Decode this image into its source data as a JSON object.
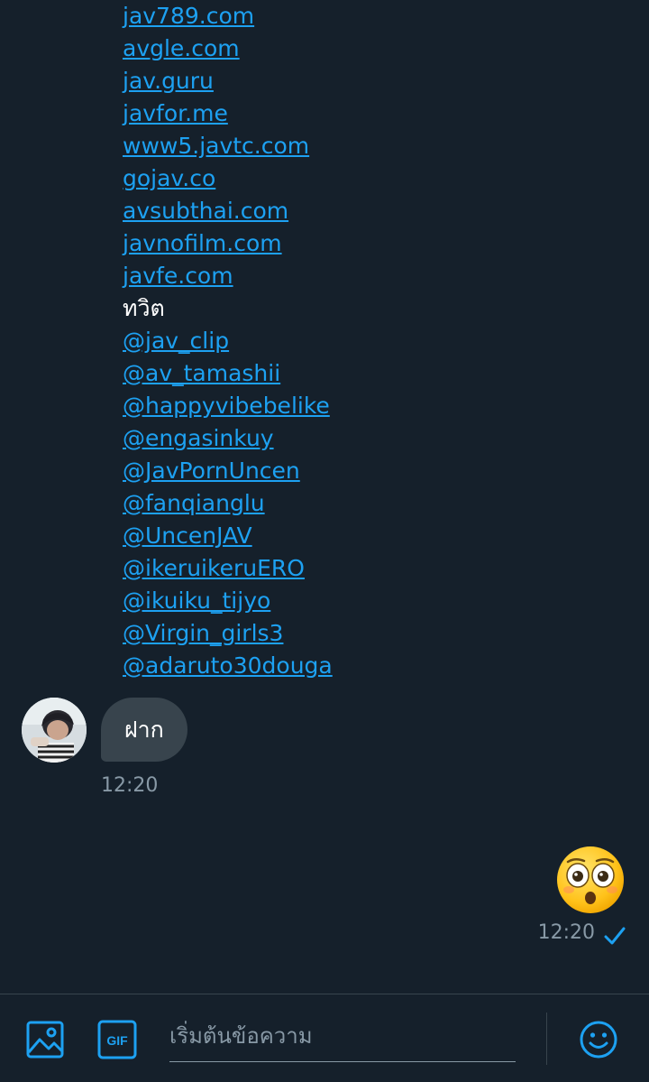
{
  "conversation": {
    "incoming_link_lines": [
      "jav789.com",
      "avgle.com",
      "jav.guru",
      "javfor.me",
      "www5.javtc.com",
      "gojav.co",
      "avsubthai.com",
      "javnofilm.com",
      "javfe.com",
      "ทวิต",
      "@jav_clip",
      "@av_tamashii",
      "@happyvibebelike",
      "@engasinkuy",
      "@JavPornUncen",
      "@fanqianglu",
      "@UncenJAV",
      "@ikeruikeruERO",
      "@ikuiku_tijyo",
      "@Virgin_girls3",
      "@adaruto30douga"
    ],
    "incoming_message": {
      "text": "ฝาก",
      "time": "12:20"
    },
    "outgoing_message": {
      "emoji": "flushed-face-emoji",
      "time": "12:20",
      "status_icon": "check-icon"
    }
  },
  "composer": {
    "placeholder": "เริ่มต้นข้อความ",
    "value": "",
    "media_icon": "image-icon",
    "gif_label": "GIF",
    "emoji_icon": "smiley-icon"
  },
  "colors": {
    "background": "#15202b",
    "link": "#1da1f2",
    "bubble_incoming": "#38444d",
    "muted_text": "#8899a6"
  }
}
